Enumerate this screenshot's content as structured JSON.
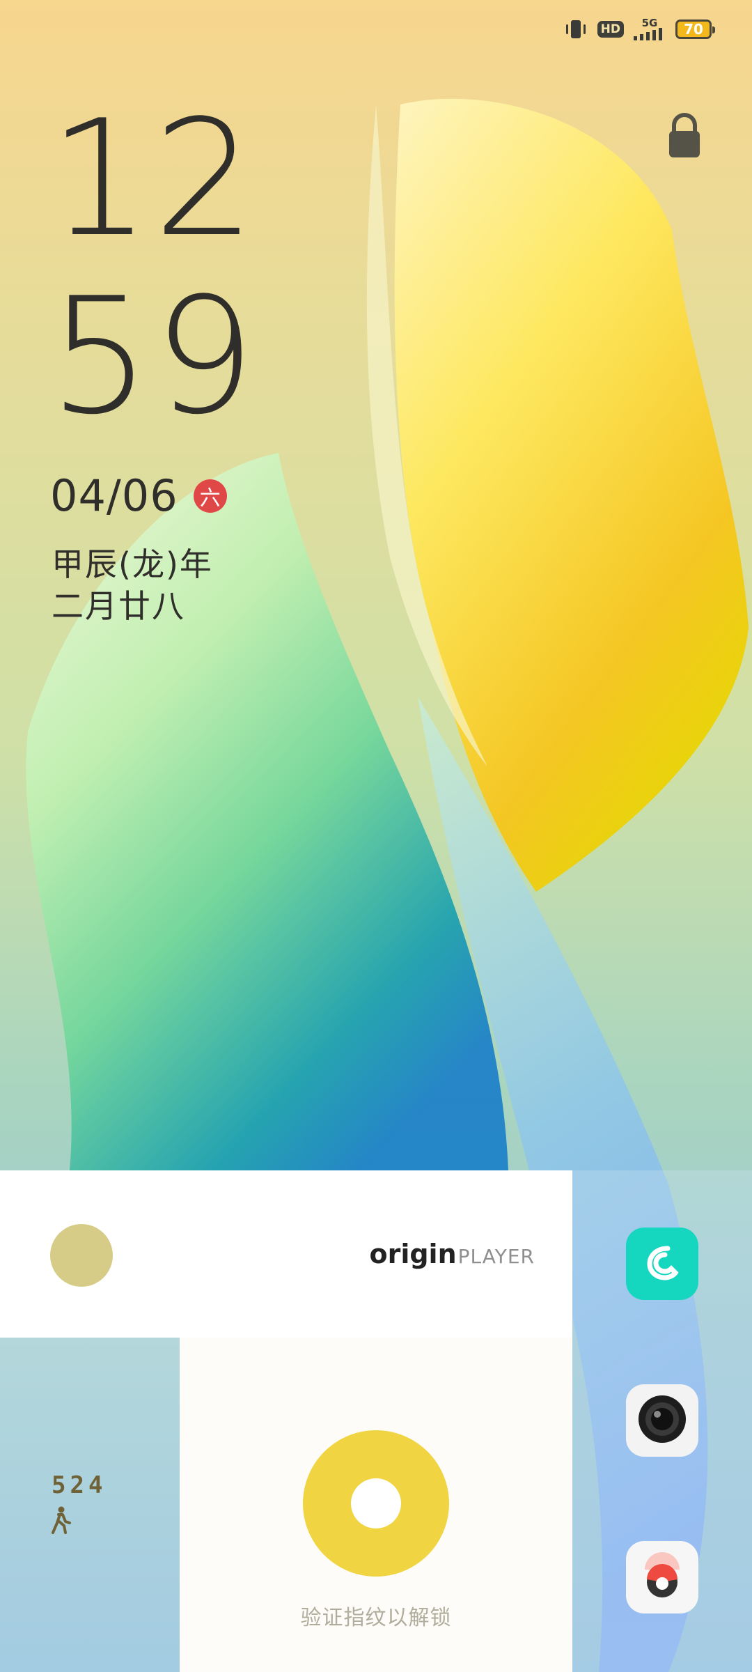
{
  "status_bar": {
    "icons": [
      "vibrate-icon",
      "hd-icon",
      "5g-signal-icon",
      "battery-icon"
    ],
    "hd_label": "HD",
    "network_label": "5G",
    "battery_level": "70",
    "battery_color": "#f2b81c"
  },
  "lockscreen": {
    "hour": "12",
    "minute": "59",
    "date": "04/06",
    "weekday": "六",
    "weekday_badge_color": "#e04848",
    "lunar_year": "甲辰(龙)年",
    "lunar_date": "二月廿八",
    "lock_icon": "padlock-icon"
  },
  "player_widget": {
    "logo_bold": "origin",
    "logo_light": "PLAYER",
    "dot_color": "#d6cc87"
  },
  "steps_widget": {
    "count": "524",
    "icon": "walk-icon"
  },
  "unlock": {
    "hint": "验证指纹以解锁",
    "ring_color": "#f0d441"
  },
  "shortcuts": [
    {
      "name": "phone",
      "icon": "phone-icon",
      "color": "#15d6bf"
    },
    {
      "name": "camera",
      "icon": "camera-icon",
      "color": "#f3f3f3"
    },
    {
      "name": "app",
      "icon": "app-icon",
      "color": "#f6f6f6"
    }
  ]
}
